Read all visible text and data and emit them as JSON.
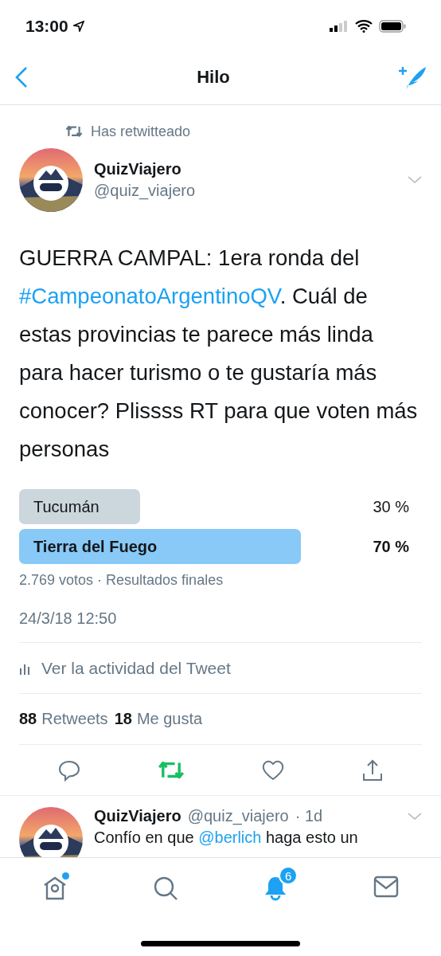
{
  "status_bar": {
    "time": "13:00"
  },
  "nav": {
    "title": "Hilo"
  },
  "tweet": {
    "retweet_label": "Has retwitteado",
    "author": {
      "name": "QuizViajero",
      "handle": "@quiz_viajero"
    },
    "text": [
      {
        "kind": "text",
        "text": "GUERRA CAMPAL: 1era ronda del "
      },
      {
        "kind": "hashtag",
        "text": "#CampeonatoArgentinoQV"
      },
      {
        "kind": "text",
        "text": ". Cuál de estas provincias te parece más linda para hacer turismo o te gustaría más conocer? Plissss RT para que voten más personas"
      }
    ],
    "poll": {
      "options": [
        {
          "label": "Tucumán",
          "percent": "30 %",
          "selected": false
        },
        {
          "label": "Tierra del Fuego",
          "percent": "70 %",
          "selected": true
        }
      ],
      "summary": "2.769 votos · Resultados finales"
    },
    "timestamp": "24/3/18 12:50",
    "activity_link": "Ver la actividad del Tweet",
    "stats": [
      {
        "count": "88",
        "label": "Retweets"
      },
      {
        "count": "18",
        "label": "Me gusta"
      }
    ],
    "actions": [
      {
        "kind": "reply",
        "active": false
      },
      {
        "kind": "retweet",
        "active": true
      },
      {
        "kind": "like",
        "active": false
      },
      {
        "kind": "share",
        "active": false
      }
    ]
  },
  "reply": {
    "name": "QuizViajero",
    "handle": "@quiz_viajero",
    "age": "· 1d",
    "text": [
      {
        "kind": "text",
        "text": "Confío en que "
      },
      {
        "kind": "mention",
        "text": "@berlich"
      },
      {
        "kind": "text",
        "text": " haga esto un"
      }
    ]
  },
  "tab_bar": {
    "items": [
      {
        "kind": "home",
        "selected": false,
        "dot": true
      },
      {
        "kind": "search",
        "selected": false,
        "dot": false
      },
      {
        "kind": "notifications",
        "selected": true,
        "dot": false,
        "badge": "6"
      },
      {
        "kind": "messages",
        "selected": false,
        "dot": false
      }
    ]
  }
}
